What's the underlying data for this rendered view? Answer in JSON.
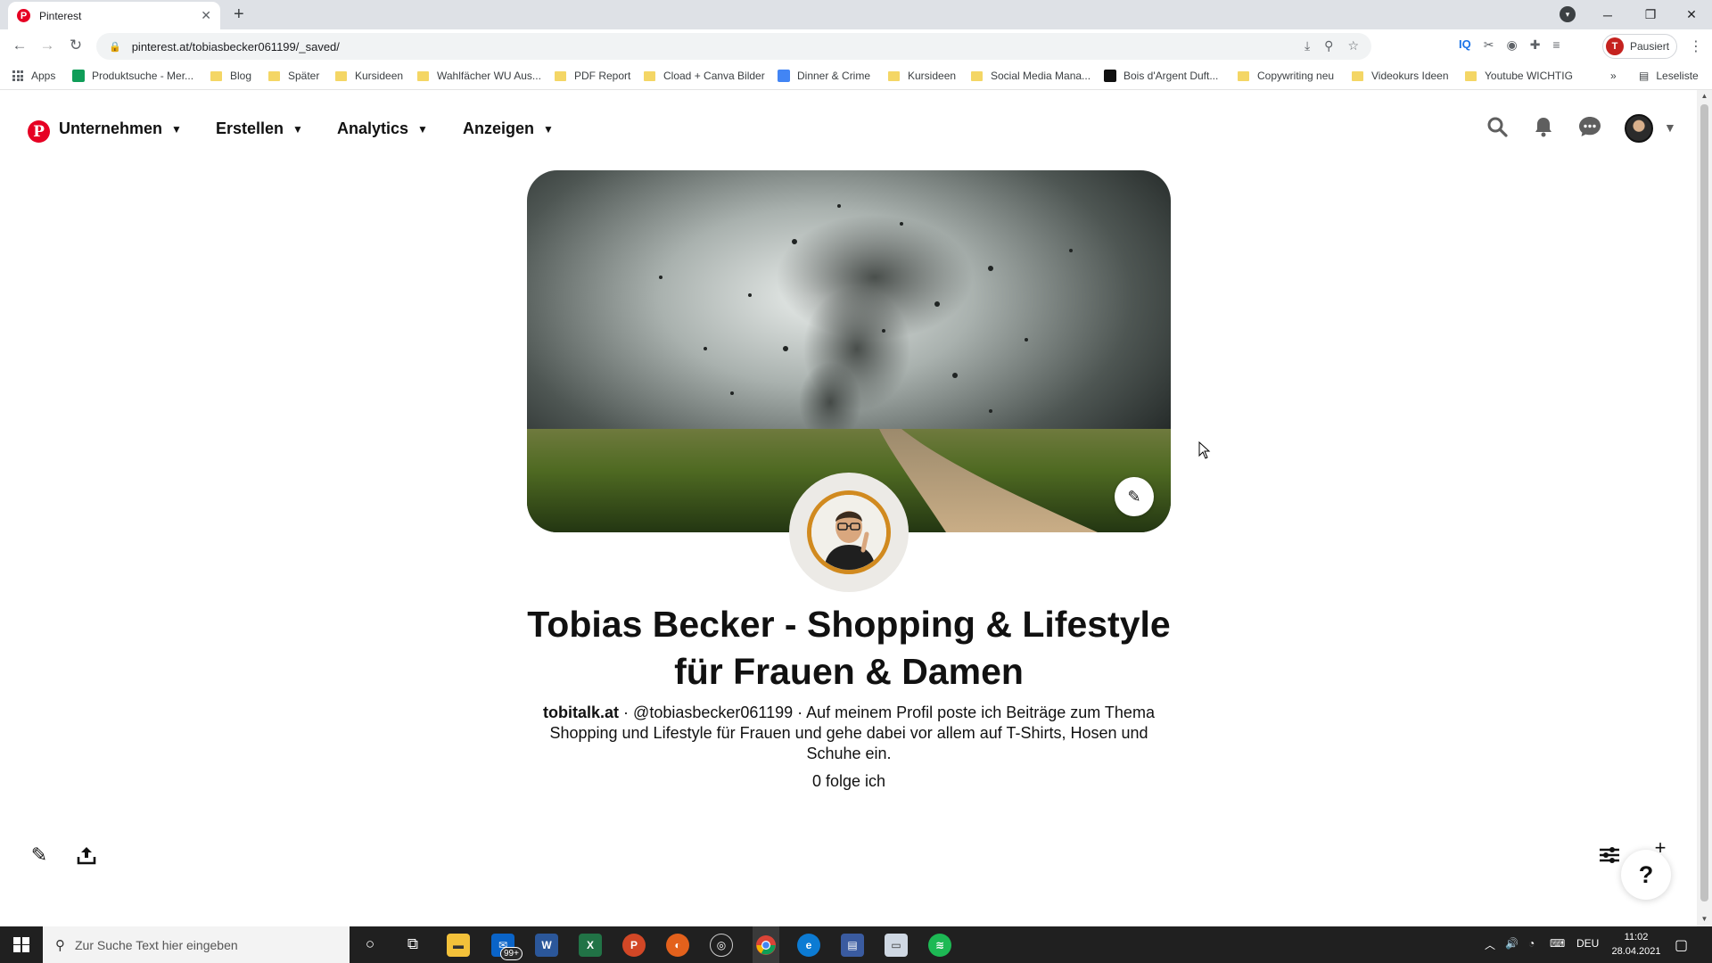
{
  "browser": {
    "tab_title": "Pinterest",
    "tab_favicon": "P",
    "tab_close": "✕",
    "new_tab": "+",
    "url": "pinterest.at/tobiasbecker061199/_saved/",
    "profile_initial": "T",
    "profile_label": "Pausiert",
    "ext_iq": "IQ",
    "window_controls": {
      "minimize": "─",
      "maximize": "❐",
      "close": "✕"
    }
  },
  "bookmarks": [
    {
      "label": "Apps",
      "type": "apps"
    },
    {
      "label": "Produktsuche - Mer...",
      "type": "site",
      "color": "#0f9d58"
    },
    {
      "label": "Blog",
      "type": "folder"
    },
    {
      "label": "Später",
      "type": "folder"
    },
    {
      "label": "Kursideen",
      "type": "folder"
    },
    {
      "label": "Wahlfächer WU Aus...",
      "type": "folder"
    },
    {
      "label": "PDF Report",
      "type": "folder"
    },
    {
      "label": "Cload + Canva Bilder",
      "type": "folder"
    },
    {
      "label": "Dinner & Crime",
      "type": "site",
      "color": "#4285f4"
    },
    {
      "label": "Kursideen",
      "type": "folder"
    },
    {
      "label": "Social Media Mana...",
      "type": "folder"
    },
    {
      "label": "Bois d'Argent Duft...",
      "type": "site",
      "color": "#111111"
    },
    {
      "label": "Copywriting neu",
      "type": "folder"
    },
    {
      "label": "Videokurs Ideen",
      "type": "folder"
    },
    {
      "label": "Youtube WICHTIG",
      "type": "folder"
    }
  ],
  "bookmarks_more": "»",
  "reading_list": "Leseliste",
  "pinterest": {
    "logo": "P",
    "accent": "#e60023",
    "nav": [
      {
        "label": "Unternehmen"
      },
      {
        "label": "Erstellen"
      },
      {
        "label": "Analytics"
      },
      {
        "label": "Anzeigen"
      }
    ]
  },
  "profile": {
    "name": "Tobias Becker - Shopping & Lifestyle für Frauen & Damen",
    "website": "tobitalk.at",
    "handle": " · @tobiasbecker061199 · ",
    "bio": "Auf meinem Profil poste ich Beiträge zum Thema Shopping und Lifestyle für Frauen und gehe dabei vor allem auf T-Shirts, Hosen und Schuhe ein.",
    "following": "0 folge ich",
    "avatar_ring_color": "#d18a1f"
  },
  "help_label": "?",
  "taskbar": {
    "search_placeholder": "Zur Suche Text hier eingeben",
    "mail_badge": "99+",
    "language": "DEU",
    "time": "11:02",
    "date": "28.04.2021"
  }
}
